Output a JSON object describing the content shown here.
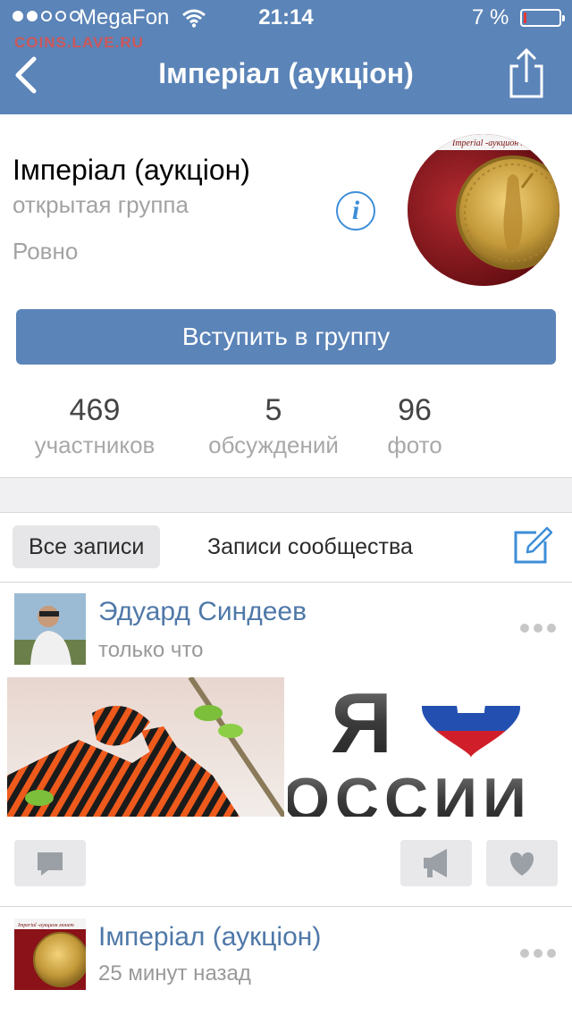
{
  "status_bar": {
    "signal_bars_filled": 2,
    "signal_bars_total": 5,
    "carrier": "MegaFon",
    "time": "21:14",
    "battery_percent": "7 %",
    "battery_level": 0.07,
    "icons": [
      "wifi-icon",
      "battery-icon"
    ]
  },
  "watermark": "COINS.LAVE.RU",
  "nav": {
    "title": "Імперіал (аукціон)",
    "back_icon": "chevron-left-icon",
    "share_icon": "share-icon"
  },
  "group": {
    "name": "Імперіал (аукціон)",
    "type": "открытая группа",
    "city": "Ровно",
    "info_icon": "info-icon",
    "avatar_caption": "Imperial -аукцион монет",
    "join_label": "Вступить в группу"
  },
  "stats": [
    {
      "value": "469",
      "label": "участников"
    },
    {
      "value": "5",
      "label": "обсуждений"
    },
    {
      "value": "96",
      "label": "фото"
    }
  ],
  "tabs": {
    "all_posts": "Все записи",
    "community_posts": "Записи сообщества",
    "compose_icon": "compose-icon"
  },
  "posts": [
    {
      "author": "Эдуард Синдеев",
      "time": "только что",
      "photo_2_text_big": "Я",
      "photo_2_text_bottom": "ОССИИ",
      "actions": [
        "comment-icon",
        "megaphone-icon",
        "heart-icon"
      ]
    },
    {
      "author": "Імперіал (аукціон)",
      "time": "25 минут назад",
      "avatar_caption": "Imperial -аукцион монет"
    }
  ],
  "colors": {
    "brand_blue": "#5b84b8",
    "link_blue": "#4f78a8",
    "info_blue": "#3d8ed8",
    "muted_gray": "#a3a3a3",
    "battery_red": "#e53935"
  }
}
